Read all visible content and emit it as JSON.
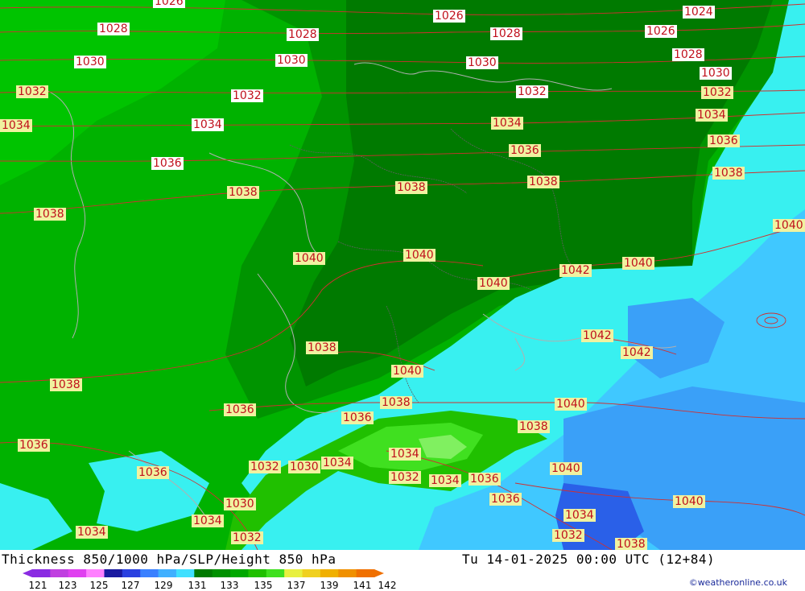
{
  "title": "Thickness 850/1000 hPa/SLP/Height 850 hPa",
  "datetime": "Tu 14-01-2025 00:00 UTC (12+84)",
  "credit": "©weatheronline.co.uk",
  "legend": {
    "ticks": [
      "121",
      "123",
      "125",
      "127",
      "129",
      "131",
      "133",
      "135",
      "137",
      "139",
      "141",
      "142"
    ],
    "colors": [
      "#8a2be2",
      "#c040e0",
      "#e040f0",
      "#ff80ff",
      "#1a1aa0",
      "#2a40e0",
      "#3a80ff",
      "#40b0ff",
      "#40e0ff",
      "#007a00",
      "#009000",
      "#00a800",
      "#20c000",
      "#40e020",
      "#e8f040",
      "#f0d020",
      "#f0b000",
      "#f09000",
      "#f07000"
    ]
  },
  "isobars": [
    {
      "text": "1026",
      "style": "w"
    },
    {
      "text": "1026",
      "style": "w"
    },
    {
      "text": "1024",
      "style": "w"
    },
    {
      "text": "1028",
      "style": "w"
    },
    {
      "text": "1028",
      "style": "w"
    },
    {
      "text": "1028",
      "style": "w"
    },
    {
      "text": "1026",
      "style": "w"
    },
    {
      "text": "1028",
      "style": "w"
    },
    {
      "text": "1030",
      "style": "w"
    },
    {
      "text": "1030",
      "style": "w"
    },
    {
      "text": "1030",
      "style": "w"
    },
    {
      "text": "1030",
      "style": "w"
    },
    {
      "text": "1032",
      "style": "y"
    },
    {
      "text": "1032",
      "style": "w"
    },
    {
      "text": "1032",
      "style": "w"
    },
    {
      "text": "1032",
      "style": "y"
    },
    {
      "text": "1034",
      "style": "y"
    },
    {
      "text": "1034",
      "style": "w"
    },
    {
      "text": "1034",
      "style": "y"
    },
    {
      "text": "1034",
      "style": "y"
    },
    {
      "text": "1036",
      "style": "w"
    },
    {
      "text": "1036",
      "style": "y"
    },
    {
      "text": "1036",
      "style": "y"
    },
    {
      "text": "1038",
      "style": "y"
    },
    {
      "text": "1038",
      "style": "y"
    },
    {
      "text": "1038",
      "style": "y"
    },
    {
      "text": "1038",
      "style": "y"
    },
    {
      "text": "1038",
      "style": "y"
    },
    {
      "text": "1040",
      "style": "y"
    },
    {
      "text": "1040",
      "style": "y"
    },
    {
      "text": "1040",
      "style": "y"
    },
    {
      "text": "1040",
      "style": "y"
    },
    {
      "text": "1040",
      "style": "y"
    },
    {
      "text": "1042",
      "style": "y"
    },
    {
      "text": "1038",
      "style": "y"
    },
    {
      "text": "1038",
      "style": "y"
    },
    {
      "text": "1036",
      "style": "y"
    },
    {
      "text": "1042",
      "style": "y"
    },
    {
      "text": "1042",
      "style": "y"
    },
    {
      "text": "1040",
      "style": "y"
    },
    {
      "text": "1040",
      "style": "y"
    },
    {
      "text": "1038",
      "style": "y"
    },
    {
      "text": "1036",
      "style": "y"
    },
    {
      "text": "1036",
      "style": "y"
    },
    {
      "text": "1038",
      "style": "y"
    },
    {
      "text": "1036",
      "style": "y"
    },
    {
      "text": "1034",
      "style": "y"
    },
    {
      "text": "1032",
      "style": "y"
    },
    {
      "text": "1030",
      "style": "y"
    },
    {
      "text": "1034",
      "style": "y"
    },
    {
      "text": "1032",
      "style": "y"
    },
    {
      "text": "1034",
      "style": "y"
    },
    {
      "text": "1036",
      "style": "y"
    },
    {
      "text": "1040",
      "style": "y"
    },
    {
      "text": "1036",
      "style": "y"
    },
    {
      "text": "1040",
      "style": "y"
    },
    {
      "text": "1030",
      "style": "y"
    },
    {
      "text": "1034",
      "style": "y"
    },
    {
      "text": "1034",
      "style": "y"
    },
    {
      "text": "1034",
      "style": "y"
    },
    {
      "text": "1032",
      "style": "y"
    },
    {
      "text": "1032",
      "style": "y"
    },
    {
      "text": "1038",
      "style": "y"
    },
    {
      "text": "1040",
      "style": "y"
    },
    {
      "text": "1038",
      "style": "y"
    }
  ]
}
